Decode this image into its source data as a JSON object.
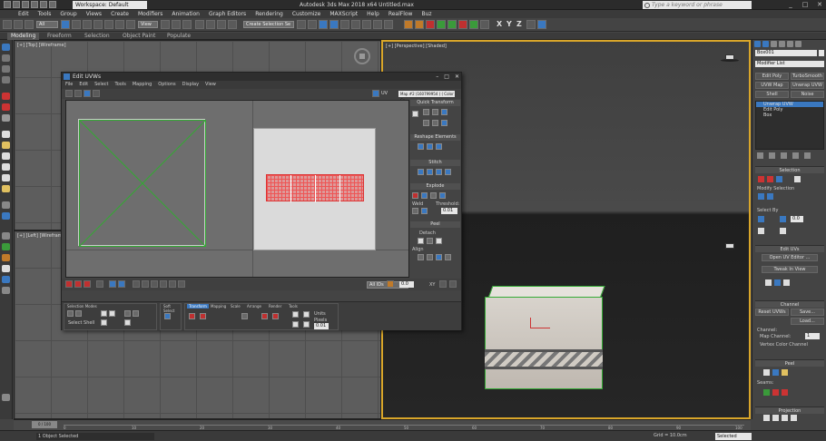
{
  "titlebar": {
    "workspace_label": "Workspace: Default",
    "app_title": "Autodesk 3ds Max 2018 x64    Untitled.max",
    "search_placeholder": "Type a keyword or phrase"
  },
  "menu": [
    "Edit",
    "Tools",
    "Group",
    "Views",
    "Create",
    "Modifiers",
    "Animation",
    "Graph Editors",
    "Rendering",
    "Customize",
    "MAXScript",
    "Help",
    "RealFlow",
    "Buz"
  ],
  "toolbar": {
    "selection_filter": "All",
    "view_dropdown": "View",
    "named_selection": "Create Selection Se",
    "axis_x": "X",
    "axis_y": "Y",
    "axis_z": "Z"
  },
  "ribbon": {
    "tabs": [
      "Modeling",
      "Freeform",
      "Selection",
      "Object Paint",
      "Populate"
    ]
  },
  "viewports": {
    "top_label": "[+] [Top] [Wireframe]",
    "left_label": "[+] [Left] [Wireframe]",
    "persp_label": "[+] [Perspective] [Shaded]"
  },
  "cmdpanel": {
    "object_name": "Box001",
    "modifier_list": "Modifier List",
    "buttons": [
      "Edit Poly",
      "TurboSmooth",
      "UVW Map",
      "Unwrap UVW",
      "Shell",
      "Noise"
    ],
    "stack": [
      "Unwrap UVW",
      "Edit Poly",
      "Box"
    ],
    "selection_title": "Selection",
    "modify_selection": "Modify Selection",
    "select_by": "Select By",
    "select_by_value": "0.0",
    "edit_uvs_title": "Edit UVs",
    "open_uv_editor": "Open UV Editor ...",
    "tweak_in_view": "Tweak In View",
    "channel_title": "Channel",
    "reset_uvws": "Reset UVWs",
    "save": "Save...",
    "load": "Load...",
    "channel_label": "Channel:",
    "map_channel": "Map Channel:",
    "map_channel_value": "1",
    "vertex_color_channel": "Vertex Color Channel",
    "peel_title": "Peel",
    "seams_label": "Seams:",
    "projection_title": "Projection"
  },
  "uvw": {
    "title": "Edit UVWs",
    "menu": [
      "File",
      "Edit",
      "Select",
      "Tools",
      "Mapping",
      "Options",
      "Display",
      "View"
    ],
    "uv_label": "UV",
    "map_dropdown": "Map #2 (160799954 ) ( Color Co",
    "quick_transform": "Quick Transform",
    "reshape_elements": "Reshape Elements",
    "stitch": "Stitch",
    "explode": "Explode",
    "weld": "Weld",
    "threshold": "Threshold:",
    "threshold_value": "0.01",
    "peel": "Peel",
    "detach": "Detach",
    "align": "Align",
    "view_value": "All IDs",
    "zoom_value": "0.0",
    "xy_label": "XY",
    "lower_groups": {
      "selection_modes": "Selection Modes",
      "select_shell": "Select Shell",
      "soft_select": "Soft Select",
      "tabs": [
        "Transform",
        "Mapping",
        "Scale",
        "Arrange",
        "Render",
        "Tools"
      ],
      "units_label": "Units",
      "pixels_label": "Pixels",
      "pixels_value": "0.01"
    }
  },
  "timeline": {
    "slider": "0 / 100",
    "ticks": [
      "0",
      "10",
      "20",
      "30",
      "40",
      "50",
      "60",
      "70",
      "80",
      "90",
      "100"
    ]
  },
  "status": {
    "selected_text": "1 Object Selected",
    "grid_text": "Grid = 10.0cm",
    "selection_set": "Selected"
  },
  "colors": {
    "accent": "#3a78c0",
    "viewport_active": "#d9a62a",
    "uv_mesh": "#dd3333"
  }
}
